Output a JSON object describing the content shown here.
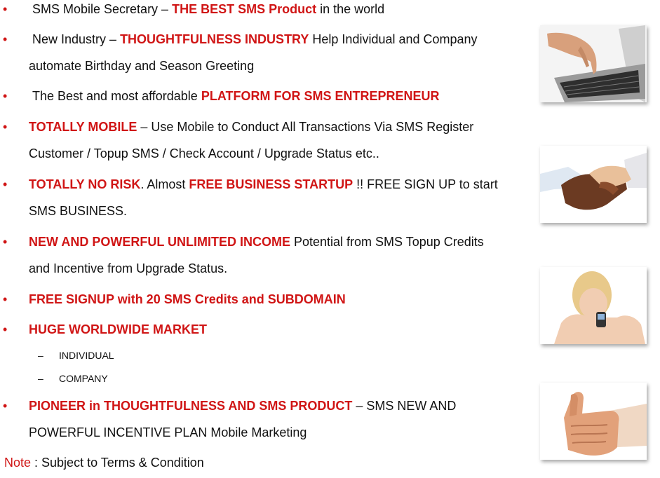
{
  "bullet_symbol": "•",
  "sub_dash": "–",
  "bullets": [
    {
      "pre": "SMS Mobile Secretary – ",
      "red": "THE BEST SMS Product",
      "post": " in the world"
    },
    {
      "pre": "New Industry – ",
      "red": "THOUGHTFULNESS  INDUSTRY",
      "post": " Help Individual and Company",
      "line2": "automate Birthday and Season Greeting"
    },
    {
      "pre": "The Best and most affordable ",
      "red": "PLATFORM FOR SMS ENTREPRENEUR",
      "post": ""
    },
    {
      "red": "TOTALLY MOBILE",
      "post": " – Use Mobile to Conduct All Transactions Via SMS Register",
      "line2": "Customer / Topup SMS / Check Account / Upgrade Status etc.."
    },
    {
      "red": "TOTALLY NO RISK",
      "mid": ". Almost ",
      "red2": "FREE BUSINESS STARTUP",
      "post": " !! FREE SIGN UP to start",
      "line2": "SMS BUSINESS."
    },
    {
      "red": "NEW AND POWERFUL UNLIMITED INCOME",
      "post": " Potential from SMS Topup Credits",
      "line2": "and Incentive from Upgrade Status."
    },
    {
      "red": "FREE SIGNUP with 20 SMS Credits and SUBDOMAIN"
    },
    {
      "red": "HUGE WORLDWIDE MARKET"
    },
    {
      "red": "PIONEER in THOUGHTFULNESS  AND SMS PRODUCT",
      "post": " – SMS NEW AND",
      "line2": "POWERFUL INCENTIVE PLAN Mobile Marketing"
    }
  ],
  "subitems": [
    "INDIVIDUAL",
    "COMPANY"
  ],
  "note": {
    "label": "Note",
    "text": " :  Subject to Terms & Condition"
  },
  "colors": {
    "accent": "#d01515",
    "text": "#111111"
  },
  "images": [
    "hand-typing-laptop-photo",
    "handshake-photo",
    "woman-with-phone-photo",
    "thumbs-up-photo"
  ]
}
